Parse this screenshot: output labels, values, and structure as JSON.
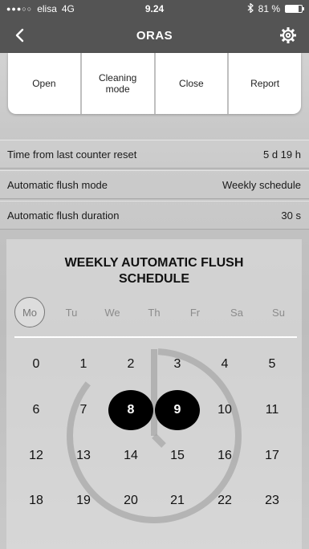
{
  "status_bar": {
    "signal_dots": "●●●○○",
    "carrier": "elisa",
    "network": "4G",
    "time": "9.24",
    "bluetooth_icon": "bluetooth-icon",
    "battery_text": "81 %",
    "battery_level": 0.81
  },
  "navbar": {
    "title": "ORAS",
    "back_icon": "chevron-left-icon",
    "settings_icon": "gear-icon"
  },
  "actions": [
    {
      "label": "Open"
    },
    {
      "label": "Cleaning\nmode"
    },
    {
      "label": "Close"
    },
    {
      "label": "Report"
    }
  ],
  "info": [
    {
      "label": "Time from last counter reset",
      "value": "5 d 19 h"
    },
    {
      "label": "Automatic flush mode",
      "value": "Weekly schedule"
    },
    {
      "label": "Automatic flush duration",
      "value": "30 s"
    }
  ],
  "schedule": {
    "title": "WEEKLY AUTOMATIC FLUSH\nSCHEDULE",
    "days": [
      "Mo",
      "Tu",
      "We",
      "Th",
      "Fr",
      "Sa",
      "Su"
    ],
    "selected_day": "Mo",
    "hours": [
      "0",
      "1",
      "2",
      "3",
      "4",
      "5",
      "6",
      "7",
      "8",
      "9",
      "10",
      "11",
      "12",
      "13",
      "14",
      "15",
      "16",
      "17",
      "18",
      "19",
      "20",
      "21",
      "22",
      "23"
    ],
    "active_hours": [
      "8",
      "9"
    ]
  },
  "colors": {
    "bar": "#545454",
    "active_hour": "#000000",
    "inactive_day": "#8c8c8c"
  }
}
